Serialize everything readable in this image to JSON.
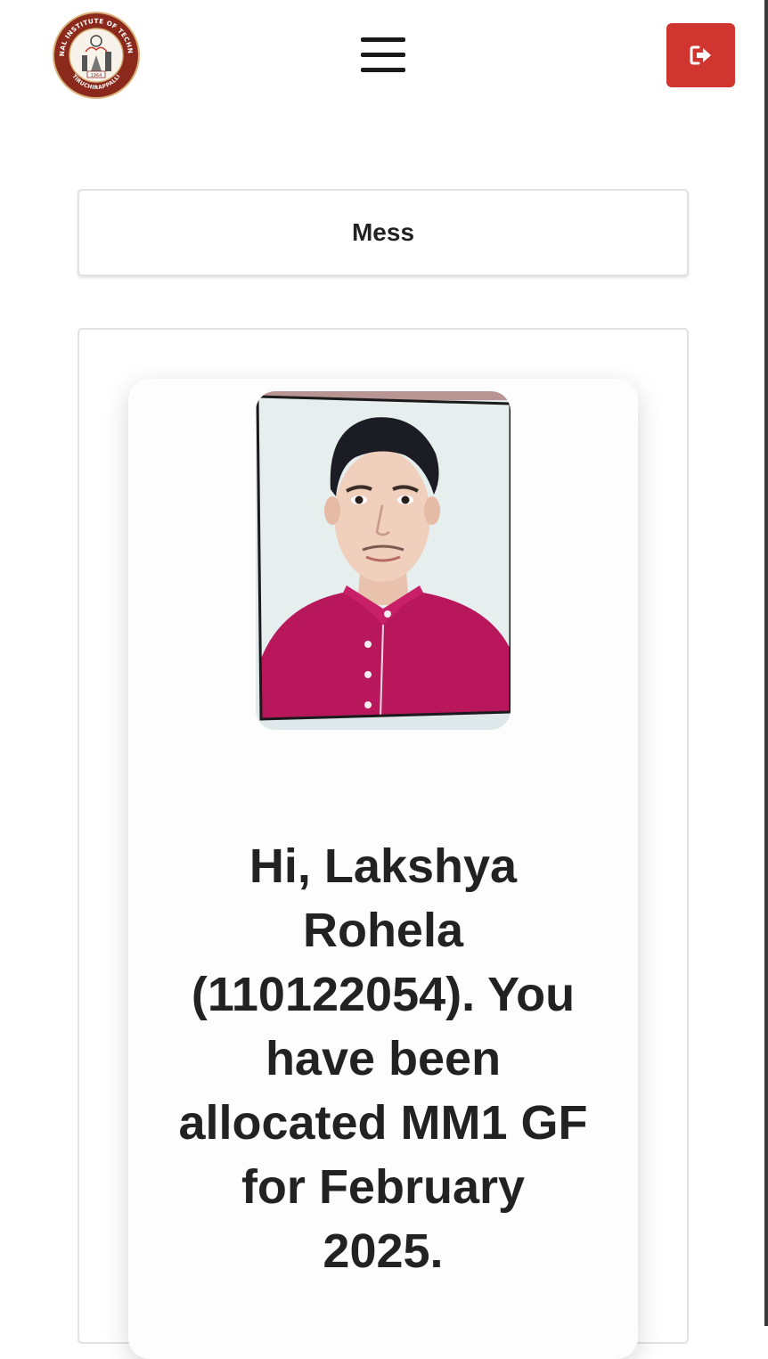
{
  "header": {
    "logo_arc_text": "NATIONAL INSTITUTE OF TECHNOLOGY",
    "logo_year": "1964",
    "logo_city": "TIRUCHIRAPPALLI",
    "menu_icon": "hamburger-menu-icon",
    "logout_icon": "sign-out-icon"
  },
  "page": {
    "title": "Mess"
  },
  "profile": {
    "greeting": "Hi, Lakshya Rohela (110122054). You have been allocated MM1 GF for February 2025."
  },
  "colors": {
    "logout_button": "#d0352f",
    "logo_maroon": "#8b2a1c",
    "shirt": "#b8175c"
  }
}
